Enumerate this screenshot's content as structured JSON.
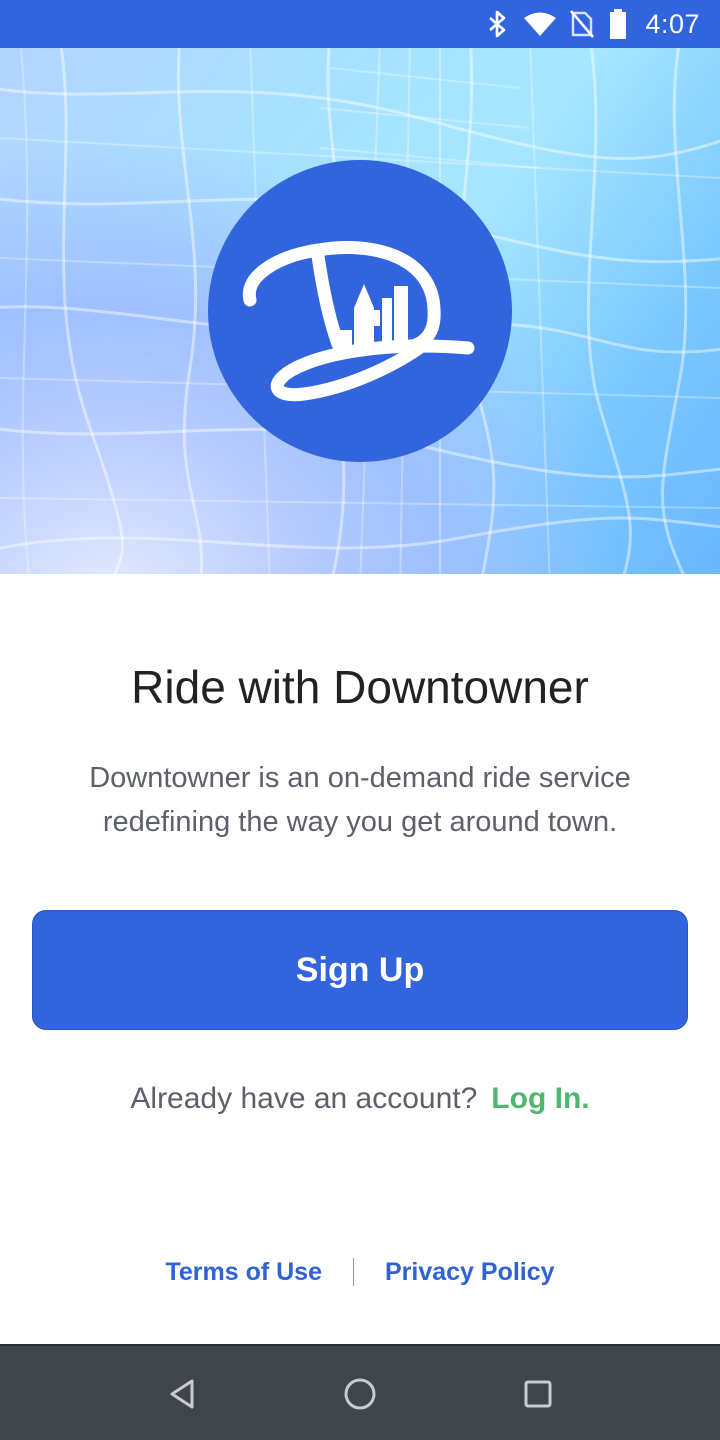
{
  "status_bar": {
    "time": "4:07",
    "icons": [
      "bluetooth-icon",
      "wifi-icon",
      "no-sim-icon",
      "battery-icon"
    ],
    "background": "#3264df"
  },
  "hero": {
    "logo_icon": "downtowner-logo-icon",
    "background_icon": "city-map-icon"
  },
  "main": {
    "title": "Ride with Downtowner",
    "description_line1": "Downtowner is an on-demand ride service",
    "description_line2": "redefining the way you get around town.",
    "signup_label": "Sign Up",
    "login_prompt": "Already have an account?",
    "login_label": "Log In."
  },
  "footer": {
    "terms_label": "Terms of Use",
    "privacy_label": "Privacy Policy"
  },
  "nav_bar": {
    "icons": [
      "back-icon",
      "home-icon",
      "recents-icon"
    ]
  },
  "colors": {
    "primary": "#3264de",
    "login_accent": "#4fb86e",
    "link": "#2f63d3",
    "nav_bar": "#3f454b"
  }
}
